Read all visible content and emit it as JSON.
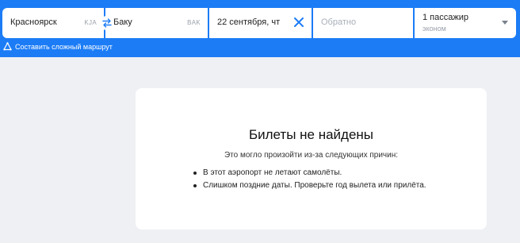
{
  "search": {
    "origin": {
      "city": "Красноярск",
      "iata": "KJA"
    },
    "destination": {
      "city": "Баку",
      "iata": "BAK"
    },
    "depart_date": "22 сентября, чт",
    "return_placeholder": "Обратно",
    "passengers": {
      "count_label": "1 пассажир",
      "class_label": "эконом"
    }
  },
  "complex_route_link": "Составить сложный маршрут",
  "empty_state": {
    "title": "Билеты не найдены",
    "subtitle": "Это могло произойти из-за следующих причин:",
    "reasons": [
      "В этот аэропорт не летают самолёты.",
      "Слишком поздние даты. Проверьте год вылета или прилёта."
    ]
  },
  "colors": {
    "brand": "#1c7cf6",
    "background": "#eef0f3",
    "card": "#ffffff"
  },
  "icons": {
    "swap": "swap-arrows-icon",
    "clear": "close-icon",
    "route": "route-icon",
    "dropdown": "chevron-down-icon"
  }
}
